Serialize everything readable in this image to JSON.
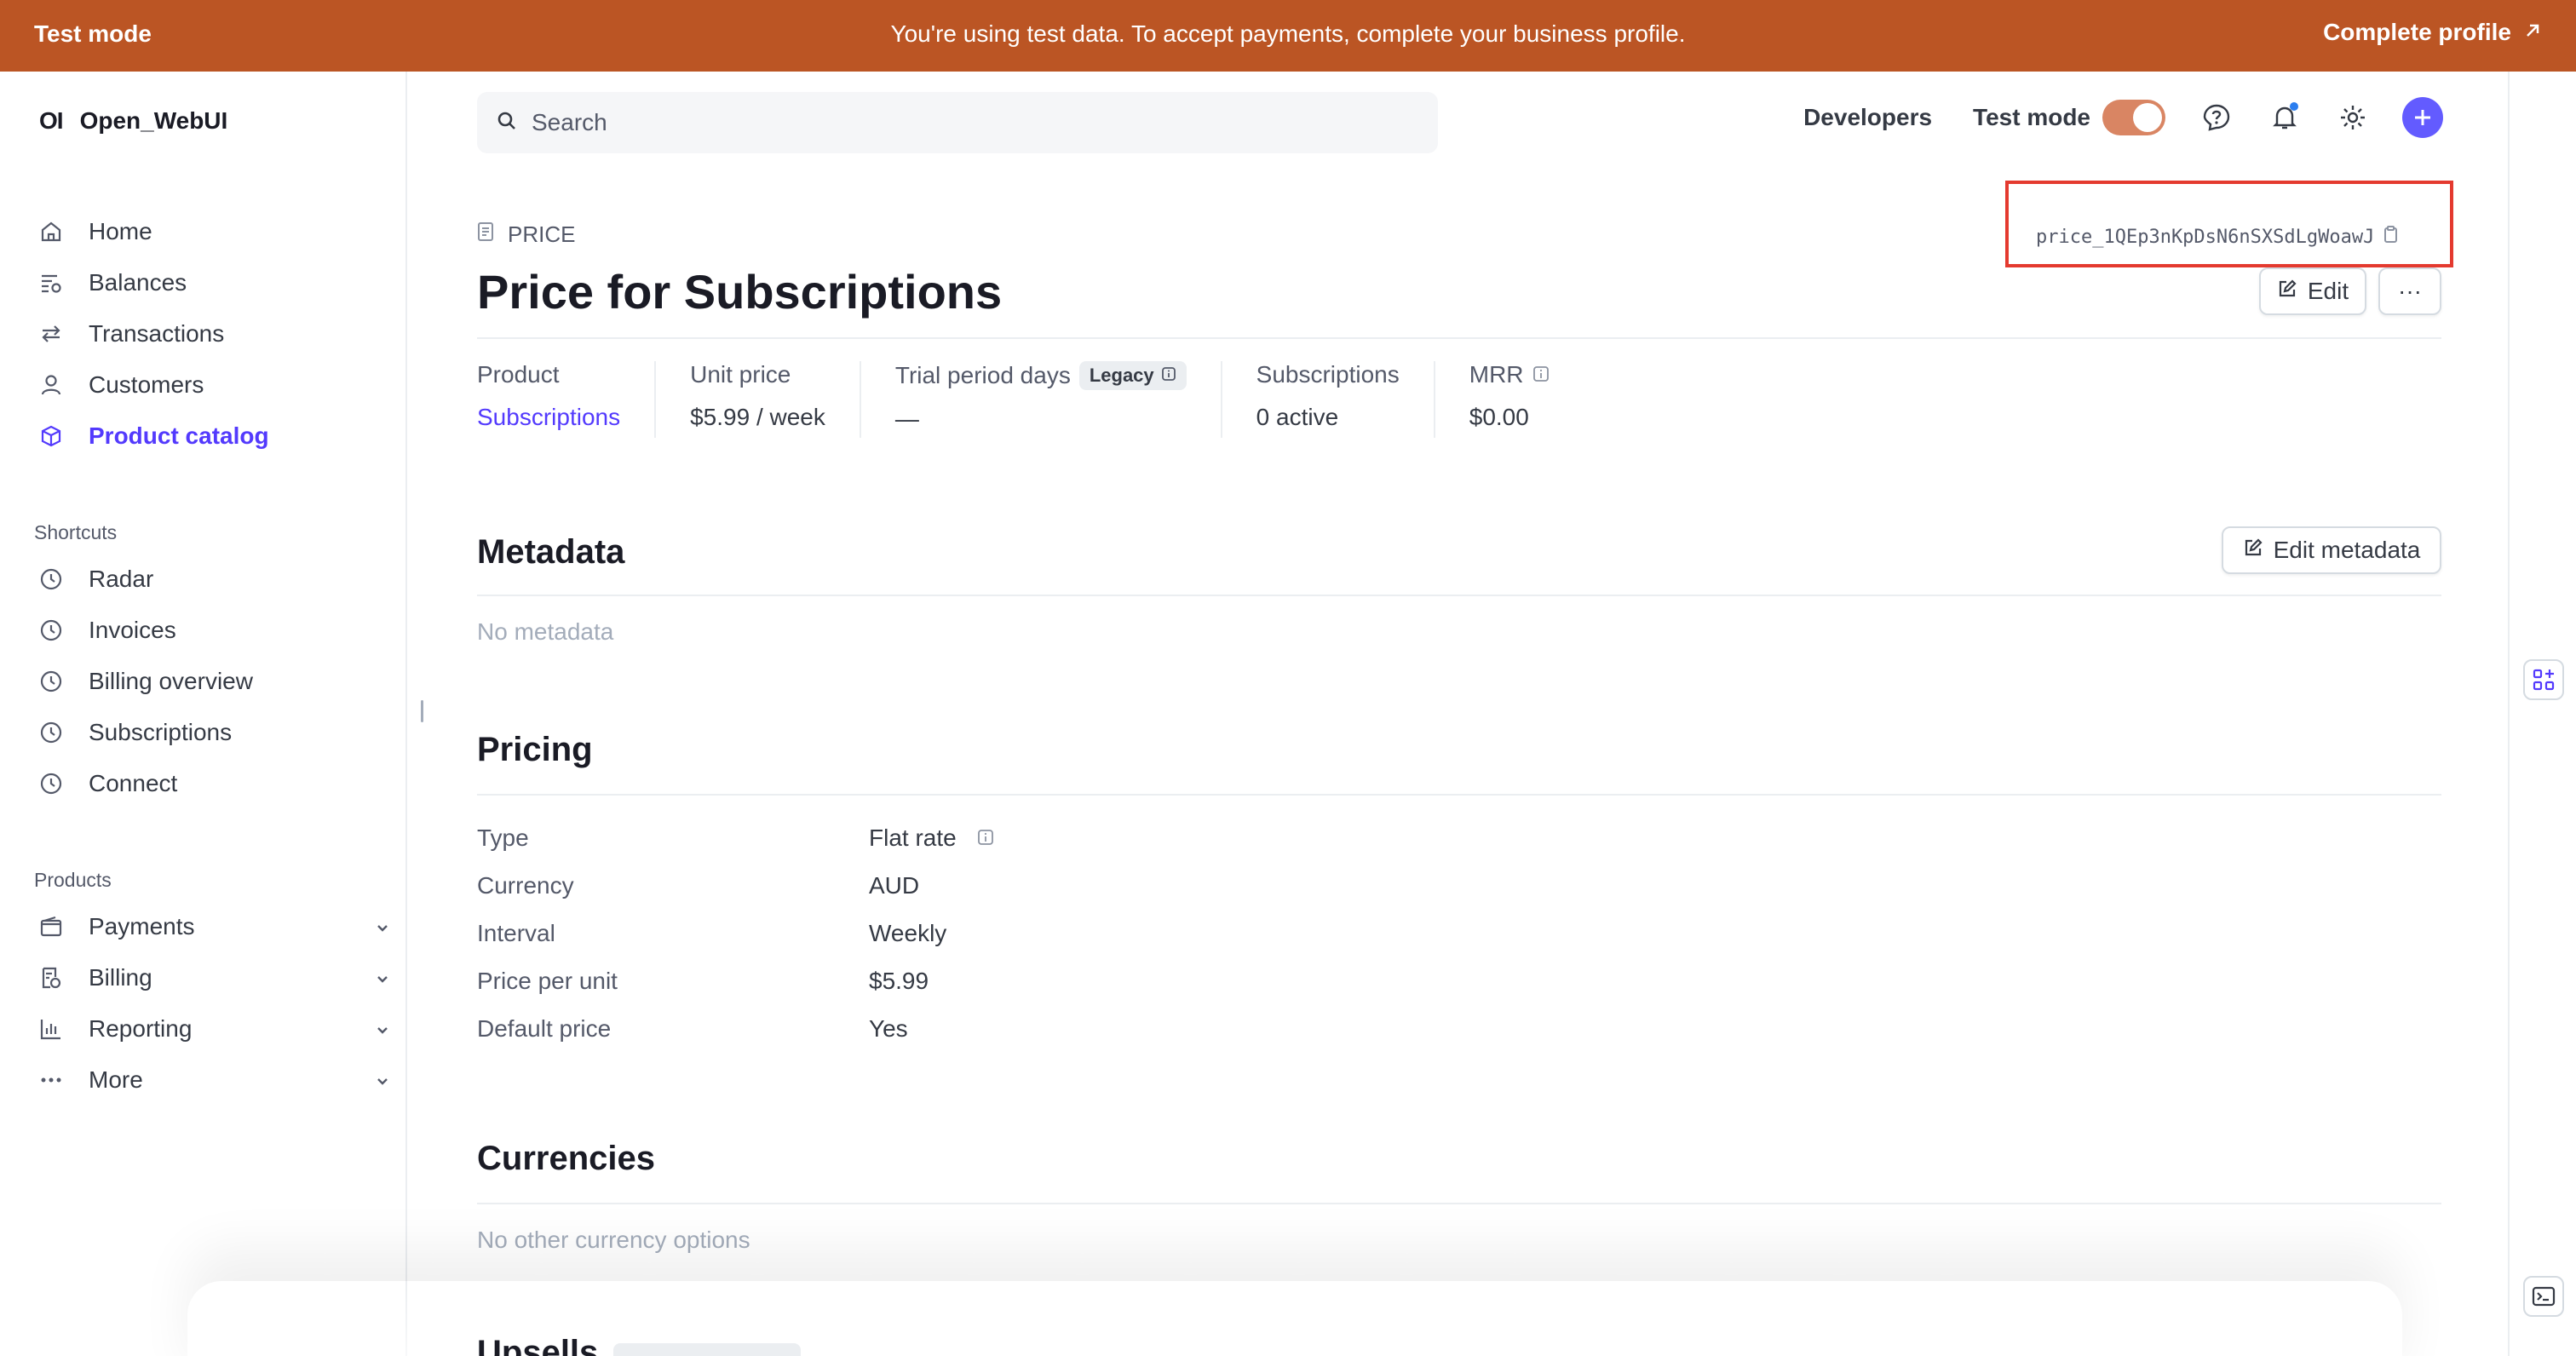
{
  "banner": {
    "mode_label": "Test mode",
    "message": "You're using test data. To accept payments, complete your business profile.",
    "cta": "Complete profile"
  },
  "brand": {
    "logo": "OI",
    "name": "Open_WebUI"
  },
  "sidebar": {
    "items": [
      {
        "label": "Home",
        "icon": "home-icon"
      },
      {
        "label": "Balances",
        "icon": "balances-icon"
      },
      {
        "label": "Transactions",
        "icon": "transactions-icon"
      },
      {
        "label": "Customers",
        "icon": "person-icon"
      },
      {
        "label": "Product catalog",
        "icon": "box-icon",
        "active": true
      }
    ],
    "shortcuts_heading": "Shortcuts",
    "shortcuts": [
      {
        "label": "Radar",
        "icon": "clock-icon"
      },
      {
        "label": "Invoices",
        "icon": "clock-icon"
      },
      {
        "label": "Billing overview",
        "icon": "clock-icon"
      },
      {
        "label": "Subscriptions",
        "icon": "clock-icon"
      },
      {
        "label": "Connect",
        "icon": "clock-icon"
      }
    ],
    "products_heading": "Products",
    "products": [
      {
        "label": "Payments",
        "icon": "wallet-icon"
      },
      {
        "label": "Billing",
        "icon": "billing-icon"
      },
      {
        "label": "Reporting",
        "icon": "chart-icon"
      },
      {
        "label": "More",
        "icon": "dots-icon"
      }
    ]
  },
  "topbar": {
    "search_placeholder": "Search",
    "developers": "Developers",
    "test_mode": "Test mode"
  },
  "page": {
    "kind_label": "PRICE",
    "title": "Price for Subscriptions",
    "price_id": "price_1QEp3nKpDsN6nSXSdLgWoawJ",
    "edit": "Edit",
    "more": "···"
  },
  "summary": {
    "product_label": "Product",
    "product_value": "Subscriptions",
    "unit_price_label": "Unit price",
    "unit_price_value": "$5.99 / week",
    "trial_label": "Trial period days",
    "trial_badge": "Legacy",
    "trial_value": "—",
    "subs_label": "Subscriptions",
    "subs_value": "0 active",
    "mrr_label": "MRR",
    "mrr_value": "$0.00"
  },
  "metadata": {
    "title": "Metadata",
    "edit_button": "Edit metadata",
    "empty": "No metadata"
  },
  "pricing": {
    "title": "Pricing",
    "rows": [
      {
        "key": "Type",
        "value": "Flat rate"
      },
      {
        "key": "Currency",
        "value": "AUD"
      },
      {
        "key": "Interval",
        "value": "Weekly"
      },
      {
        "key": "Price per unit",
        "value": "$5.99"
      },
      {
        "key": "Default price",
        "value": "Yes"
      }
    ]
  },
  "currencies": {
    "title": "Currencies",
    "empty": "No other currency options"
  },
  "upsells": {
    "title": "Upsells"
  },
  "colors": {
    "banner": "#bb5524",
    "accent": "#533afd",
    "highlight_box": "#e43a2f"
  }
}
